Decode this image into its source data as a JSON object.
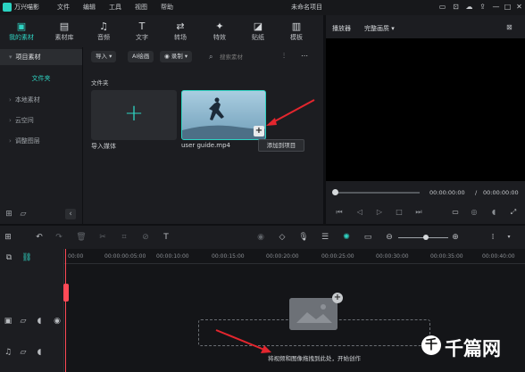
{
  "titlebar": {
    "app_name": "万兴喵影",
    "menus": [
      "文件",
      "编辑",
      "工具",
      "视图",
      "帮助"
    ],
    "project_title": "未命名项目"
  },
  "toolbar": {
    "tools": [
      {
        "label": "我的素材",
        "icon": "media-icon"
      },
      {
        "label": "素材库",
        "icon": "library-icon"
      },
      {
        "label": "音频",
        "icon": "music-icon"
      },
      {
        "label": "文字",
        "icon": "text-icon"
      },
      {
        "label": "转场",
        "icon": "transition-icon"
      },
      {
        "label": "特效",
        "icon": "effects-icon"
      },
      {
        "label": "贴纸",
        "icon": "sticker-icon"
      },
      {
        "label": "模板",
        "icon": "template-icon"
      }
    ]
  },
  "sidebar": {
    "header": "项目素材",
    "selected": "文件夹",
    "items": [
      "本地素材",
      "云空间",
      "调整图层"
    ]
  },
  "media": {
    "import_btn": "导入",
    "ai_btn": "AI绘画",
    "record_btn": "录制",
    "search_placeholder": "搜索素材",
    "folder_label": "文件夹",
    "import_label": "导入媒体",
    "clip_name": "user guide.mp4",
    "tooltip": "添加到项目"
  },
  "player": {
    "tab": "播放器",
    "quality": "完整画质",
    "time_current": "00:00:00:00",
    "time_separator": "/",
    "time_total": "00:00:00:00"
  },
  "timeline": {
    "ruler": [
      "00:00",
      "00:00:00:05:00",
      "00:00:10:00",
      "00:00:15:00",
      "00:00:20:00",
      "00:00:25:00",
      "00:00:30:00",
      "00:00:35:00",
      "00:00:40:00"
    ],
    "drop_text": "将视频和图像拖拽到此处，开始创作"
  },
  "watermark": "千篇网",
  "colors": {
    "accent": "#2fd3c2",
    "playhead": "#ff4a57"
  }
}
